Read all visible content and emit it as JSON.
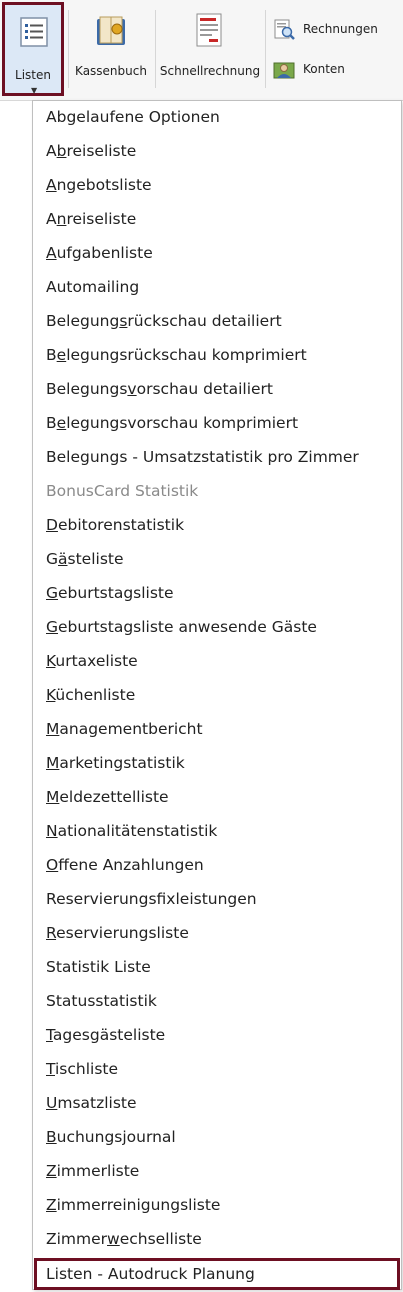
{
  "ribbon": {
    "listen_label": "Listen",
    "kassenbuch_label": "Kassenbuch",
    "schnellrechnung_label": "Schnellrechnung",
    "rechnungen_label": "Rechnungen",
    "konten_label": "Konten",
    "icons": {
      "listen": "list-icon",
      "kassenbuch": "cashbook-icon",
      "schnellrechnung": "invoice-icon",
      "rechnungen": "search-document-icon",
      "konten": "accounts-icon"
    }
  },
  "menu": {
    "items": [
      {
        "label": "Abgelaufene Optionen",
        "enabled": true
      },
      {
        "label": "Abreiseliste",
        "mnemonic": "b",
        "enabled": true
      },
      {
        "label": "Angebotsliste",
        "mnemonic": "A",
        "enabled": true
      },
      {
        "label": "Anreiseliste",
        "mnemonic": "n",
        "enabled": true
      },
      {
        "label": "Aufgabenliste",
        "mnemonic": "A",
        "enabled": true
      },
      {
        "label": "Automailing",
        "enabled": true
      },
      {
        "label": "Belegungsrückschau detailiert",
        "mnemonic": "s",
        "enabled": true
      },
      {
        "label": "Belegungsrückschau komprimiert",
        "mnemonic": "e",
        "enabled": true
      },
      {
        "label": "Belegungsvorschau detailiert",
        "mnemonic": "v",
        "enabled": true
      },
      {
        "label": "Belegungsvorschau komprimiert",
        "mnemonic": "e",
        "enabled": true
      },
      {
        "label": "Belegungs - Umsatzstatistik pro Zimmer",
        "enabled": true
      },
      {
        "label": "BonusCard Statistik",
        "enabled": false
      },
      {
        "label": "Debitorenstatistik",
        "mnemonic": "D",
        "enabled": true
      },
      {
        "label": "Gästeliste",
        "mnemonic": "ä",
        "enabled": true
      },
      {
        "label": "Geburtstagsliste",
        "mnemonic": "G",
        "enabled": true
      },
      {
        "label": "Geburtstagsliste anwesende Gäste",
        "mnemonic": "G",
        "enabled": true
      },
      {
        "label": "Kurtaxeliste",
        "mnemonic": "K",
        "enabled": true
      },
      {
        "label": "Küchenliste",
        "mnemonic": "K",
        "enabled": true
      },
      {
        "label": "Managementbericht",
        "mnemonic": "M",
        "enabled": true
      },
      {
        "label": "Marketingstatistik",
        "mnemonic": "M",
        "enabled": true
      },
      {
        "label": "Meldezettelliste",
        "mnemonic": "M",
        "enabled": true
      },
      {
        "label": "Nationalitätenstatistik",
        "mnemonic": "N",
        "enabled": true
      },
      {
        "label": "Offene Anzahlungen",
        "mnemonic": "O",
        "enabled": true
      },
      {
        "label": "Reservierungsfixleistungen",
        "enabled": true
      },
      {
        "label": "Reservierungsliste",
        "mnemonic": "R",
        "enabled": true
      },
      {
        "label": "Statistik Liste",
        "enabled": true
      },
      {
        "label": "Statusstatistik",
        "enabled": true
      },
      {
        "label": "Tagesgästeliste",
        "mnemonic": "T",
        "enabled": true
      },
      {
        "label": "Tischliste",
        "mnemonic": "T",
        "enabled": true
      },
      {
        "label": "Umsatzliste",
        "mnemonic": "U",
        "enabled": true
      },
      {
        "label": "Buchungsjournal",
        "mnemonic": "B",
        "enabled": true
      },
      {
        "label": "Zimmerliste",
        "mnemonic": "Z",
        "enabled": true
      },
      {
        "label": "Zimmerreinigungsliste",
        "mnemonic": "Z",
        "enabled": true
      },
      {
        "label": "Zimmerwechselliste",
        "mnemonic": "w",
        "enabled": true
      },
      {
        "label": "Listen - Autodruck Planung",
        "enabled": true,
        "highlighted": true
      }
    ]
  },
  "colors": {
    "highlight_border": "#6d0f22",
    "pressed_button_bg": "#dce8f6",
    "disabled_text": "#8a8a8a"
  }
}
